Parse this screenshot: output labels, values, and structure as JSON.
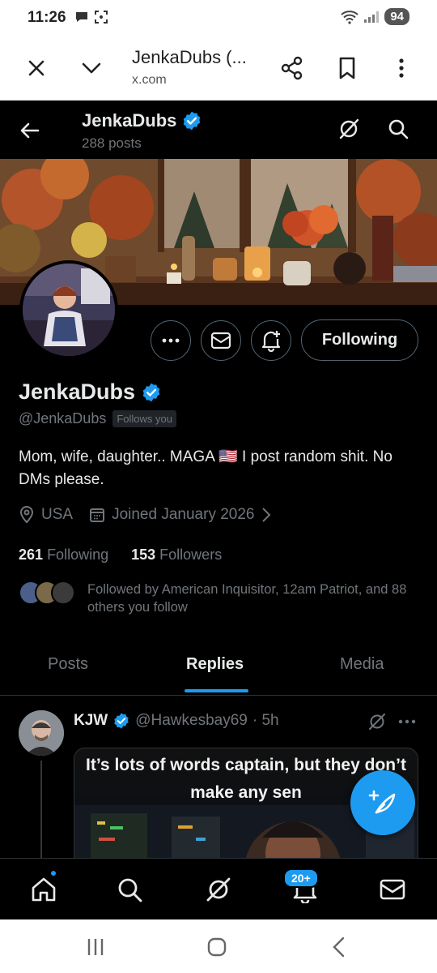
{
  "status_bar": {
    "time": "11:26",
    "battery": "94"
  },
  "browser": {
    "title": "JenkaDubs (...",
    "url": "x.com"
  },
  "header": {
    "name": "JenkaDubs",
    "posts_count": "288 posts"
  },
  "profile": {
    "name": "JenkaDubs",
    "handle": "@JenkaDubs",
    "follows_you": "Follows you",
    "bio_part1": "Mom, wife, daughter.. MAGA ",
    "bio_flag": "🇺🇸",
    "bio_part2": " I post random shit. No DMs please.",
    "location": "USA",
    "joined": "Joined January 2026",
    "following_count": "261",
    "following_label": "Following",
    "followers_count": "153",
    "followers_label": "Followers",
    "followed_by": "Followed by American Inquisitor, 12am Patriot, and 88 others you follow",
    "follow_button": "Following"
  },
  "tabs": [
    {
      "label": "Posts",
      "active": false
    },
    {
      "label": "Replies",
      "active": true
    },
    {
      "label": "Media",
      "active": false
    }
  ],
  "post": {
    "name": "KJW",
    "handle": "@Hawkesbay69",
    "time": "· 5h",
    "meme_text": "It’s lots of words captain, but they don’t make any sen"
  },
  "bottom_nav": {
    "notifications_badge": "20+"
  },
  "colors": {
    "accent": "#1d9bf0",
    "background": "#000000",
    "muted": "#71767b",
    "text": "#e7e9ea"
  },
  "icons": [
    "close-icon",
    "chevron-down-icon",
    "share-icon",
    "bookmark-icon",
    "more-vertical-icon",
    "back-arrow-icon",
    "grok-icon",
    "search-icon",
    "more-horizontal-icon",
    "mail-icon",
    "bell-plus-icon",
    "verified-badge-icon",
    "location-icon",
    "calendar-icon",
    "home-icon",
    "bell-icon",
    "compose-icon"
  ]
}
